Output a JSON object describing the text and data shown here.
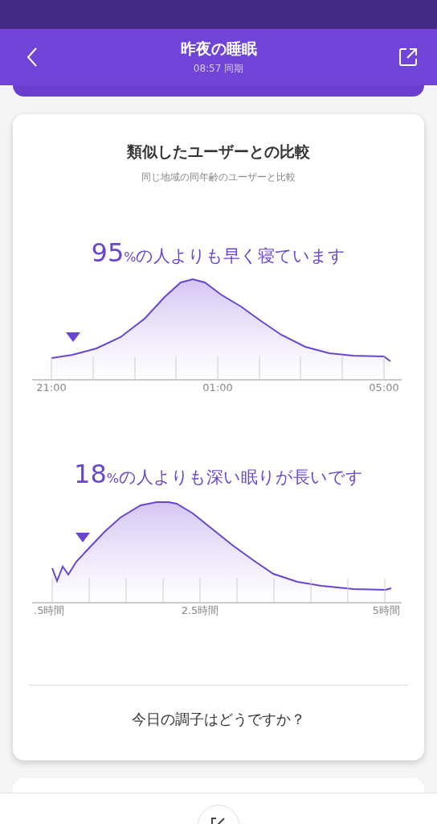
{
  "header": {
    "title": "昨夜の睡眠",
    "subtitle": "08:57 同期"
  },
  "card": {
    "title": "類似したユーザーとの比較",
    "subtitle": "同じ地域の同年齢のユーザーと比較",
    "comparisons": [
      {
        "value": "95",
        "unit": "%",
        "text": "の人よりも早く寝ています",
        "axis_labels": [
          "21:00",
          "01:00",
          "05:00"
        ]
      },
      {
        "value": "18",
        "unit": "%",
        "text": "の人よりも深い眠りが長いです",
        "axis_labels": [
          ".5時間",
          "2.5時間",
          "5時間"
        ]
      }
    ],
    "question": "今日の調子はどうですか？"
  }
}
